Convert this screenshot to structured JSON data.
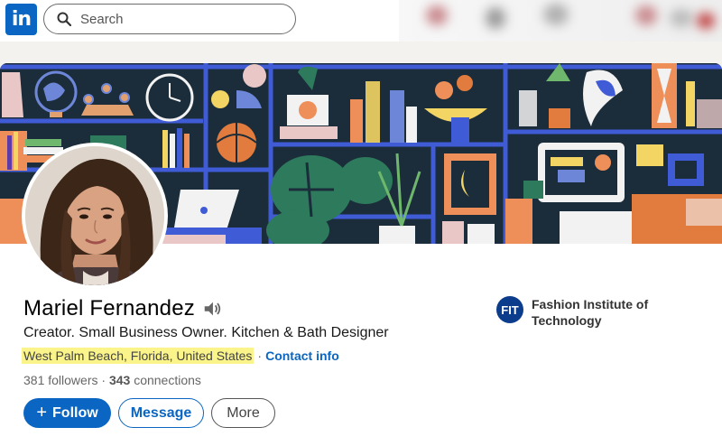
{
  "nav": {
    "logo_text": "in",
    "search_placeholder": "Search",
    "search_icon": "search-icon"
  },
  "profile": {
    "name": "Mariel Fernandez",
    "headline": "Creator. Small Business Owner. Kitchen & Bath Designer",
    "location": "West Palm Beach, Florida, United States",
    "separator": "·",
    "contact_label": "Contact info",
    "followers_count": "381",
    "followers_label": "followers",
    "connections_count": "343",
    "connections_label": "connections",
    "stats_separator": "·"
  },
  "actions": {
    "follow_plus": "+",
    "follow_label": "Follow",
    "message_label": "Message",
    "more_label": "More"
  },
  "education": {
    "logo_text": "FIT",
    "name": "Fashion Institute of Technology"
  },
  "colors": {
    "brand": "#0a66c2",
    "highlight": "#faf48a",
    "banner_bg": "#1b2d3a"
  }
}
